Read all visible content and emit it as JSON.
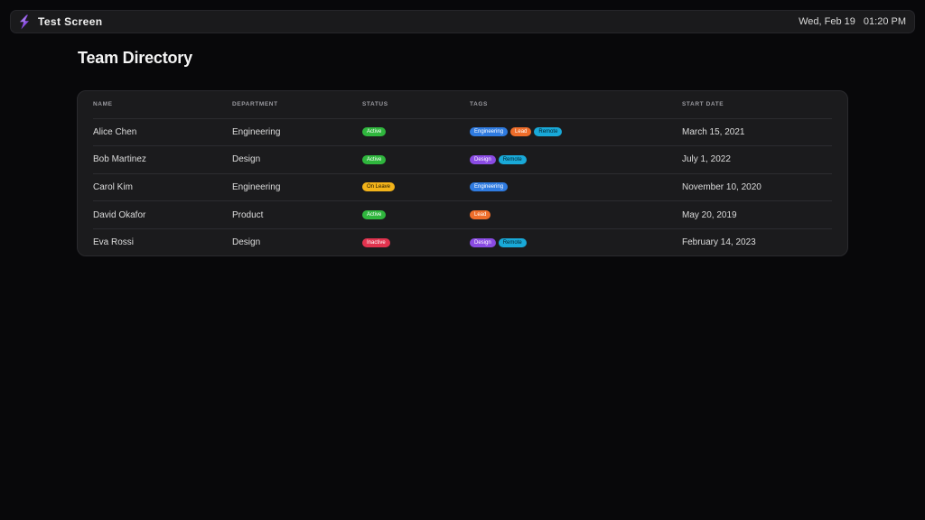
{
  "app": {
    "title": "Test Screen",
    "logo_icon": "bolt-logo-icon"
  },
  "clock": {
    "date": "Wed, Feb 19",
    "time": "01:20 PM"
  },
  "page": {
    "title": "Team Directory"
  },
  "table": {
    "columns": [
      "NAME",
      "DEPARTMENT",
      "STATUS",
      "TAGS",
      "START DATE"
    ],
    "rows": [
      {
        "name": "Alice Chen",
        "department": "Engineering",
        "status": "Active",
        "tags": [
          "Engineering",
          "Lead",
          "Remote"
        ],
        "start_date": "March 15, 2021"
      },
      {
        "name": "Bob Martinez",
        "department": "Design",
        "status": "Active",
        "tags": [
          "Design",
          "Remote"
        ],
        "start_date": "July 1, 2022"
      },
      {
        "name": "Carol Kim",
        "department": "Engineering",
        "status": "On Leave",
        "tags": [
          "Engineering"
        ],
        "start_date": "November 10, 2020"
      },
      {
        "name": "David Okafor",
        "department": "Product",
        "status": "Active",
        "tags": [
          "Lead"
        ],
        "start_date": "May 20, 2019"
      },
      {
        "name": "Eva Rossi",
        "department": "Design",
        "status": "Inactive",
        "tags": [
          "Design",
          "Remote"
        ],
        "start_date": "February 14, 2023"
      }
    ]
  },
  "colors": {
    "background": "#08080a",
    "status_active": "#2fb63d",
    "status_on_leave": "#f2b31a",
    "status_inactive": "#e1334e",
    "tag_engineering": "#2f7be0",
    "tag_lead": "#ee6d2a",
    "tag_remote": "#19a9d8",
    "tag_design": "#8a4be3",
    "logo": "#8a4be3"
  }
}
